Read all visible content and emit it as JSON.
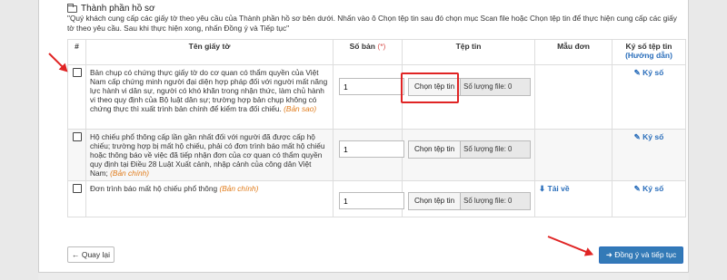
{
  "section": {
    "title": "Thành phần hồ sơ"
  },
  "notice": "\"Quý khách cung cấp các giấy tờ theo yêu cầu của Thành phần hồ sơ bên dưới. Nhấn vào ô Chọn tệp tin sau đó chọn mục Scan file hoặc Chọn tệp tin để thực hiện cung cấp các giấy tờ theo yêu cầu. Sau khi thực hiện xong, nhấn Đồng ý và Tiếp tục\"",
  "table": {
    "headers": {
      "index": "#",
      "name": "Tên giấy tờ",
      "quantity": "Số bản",
      "quantity_required": "(*)",
      "file": "Tệp tin",
      "template": "Mẫu đơn",
      "sign": "Ký số tệp tin",
      "sign_guide": "(Hướng dẫn)"
    },
    "rows": [
      {
        "name": "Bản chụp có chứng thực giấy tờ do cơ quan có thẩm quyền của Việt Nam cấp chứng minh người đại diện hợp pháp đối với người mất năng lực hành vi dân sự, người có khó khăn trong nhận thức, làm chủ hành vi theo quy định của Bộ luật dân sự; trường hợp bản chụp không có chứng thực thì xuất trình bản chính để kiểm tra đối chiếu.",
        "note": "(Bản sao)",
        "quantity": "1",
        "file_button": "Chọn tệp tin",
        "file_count": "Số lượng file: 0",
        "template_link": "",
        "sign_link": "Ký số"
      },
      {
        "name": "Hộ chiếu phổ thông cấp lần gần nhất đối với người đã được cấp hộ chiếu; trường hợp bị mất hộ chiếu, phải có đơn trình báo mất hộ chiếu hoặc thông báo về việc đã tiếp nhận đơn của cơ quan có thẩm quyền quy định tại Điều 28 Luật Xuất cảnh, nhập cảnh của công dân Việt Nam;",
        "note": "(Bản chính)",
        "quantity": "1",
        "file_button": "Chọn tệp tin",
        "file_count": "Số lượng file: 0",
        "template_link": "",
        "sign_link": "Ký số"
      },
      {
        "name": "Đơn trình báo mất hộ chiếu phổ thông",
        "note": "(Bản chính)",
        "quantity": "1",
        "file_button": "Chọn tệp tin",
        "file_count": "Số lượng file: 0",
        "template_link": "Tải về",
        "sign_link": "Ký số"
      }
    ]
  },
  "buttons": {
    "back": "Quay lại",
    "next": "Đồng ý và tiếp tục"
  },
  "colors": {
    "accent": "#337ab7",
    "link": "#2a6ebb",
    "annotation": "#e02424",
    "note": "#e07b1a"
  }
}
